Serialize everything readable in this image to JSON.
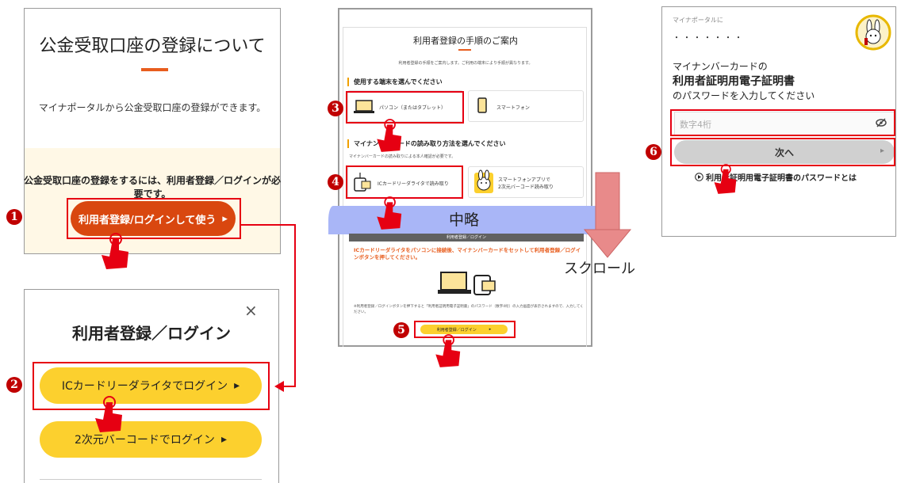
{
  "panel1": {
    "title": "公金受取口座の登録について",
    "desc": "マイナポータルから公金受取口座の登録ができます。",
    "need": "公金受取口座の登録をするには、利用者登録／ログインが必要です。",
    "button": "利用者登録/ログインして使う",
    "arrow": "▸"
  },
  "panel2": {
    "close": "×",
    "title": "利用者登録／ログイン",
    "ic_button": "ICカードリーダライタでログイン",
    "ic_arrow": "▸",
    "qr_button": "2次元バーコードでログイン",
    "qr_arrow": "▸"
  },
  "panel3": {
    "title": "利用者登録の手順のご案内",
    "intro": "利用者登録の手順をご案内します。ご利用の端末により手順が異なります。",
    "device_heading": "使用する端末を選んでください",
    "device_pc": "パソコン（またはタブレット）",
    "device_phone": "スマートフォン",
    "reader_heading": "マイナンバーカードの読み取り方法を選んでください",
    "reader_sub": "マイナンバーカードの読み取りによる本人確認が必要です。",
    "reader_ic": "ICカードリーダライタで読み取り",
    "reader_app_1": "スマートフォンアプリで",
    "reader_app_2": "2次元バーコード読み取り",
    "omitted": "中略",
    "gray_bar": "利用者登録／ログイン",
    "instruction": "ICカードリーダライタをパソコンに接続後、マイナンバーカードをセットして利用者登録／ログインボタンを押してください。",
    "note": "※利用者登録／ログインボタンを押下すると「利用者証明用電子証明書」のパスワード（数字4桁）の入力画面が表示されますので、入力してください。",
    "login_button": "利用者登録／ログイン",
    "login_arrow": "▸"
  },
  "scroll_label": "スクロール",
  "panel4": {
    "small_top": "マイナポータルに",
    "dots": "・・・・・・・",
    "line1": "マイナンバーカードの",
    "line2": "利用者証明用電子証明書",
    "line3": "のパスワードを入力してください",
    "placeholder": "数字4桁",
    "next": "次へ",
    "next_arrow": "▸",
    "link": "利用者証明用電子証明書のパスワードとは"
  },
  "steps": [
    "1",
    "2",
    "3",
    "4",
    "5",
    "6"
  ],
  "colors": {
    "highlight": "#e60012",
    "orange_button": "#d9470f",
    "yellow_button": "#fcd02e",
    "step_marker": "#c00000",
    "band": "#a9b6f7"
  }
}
